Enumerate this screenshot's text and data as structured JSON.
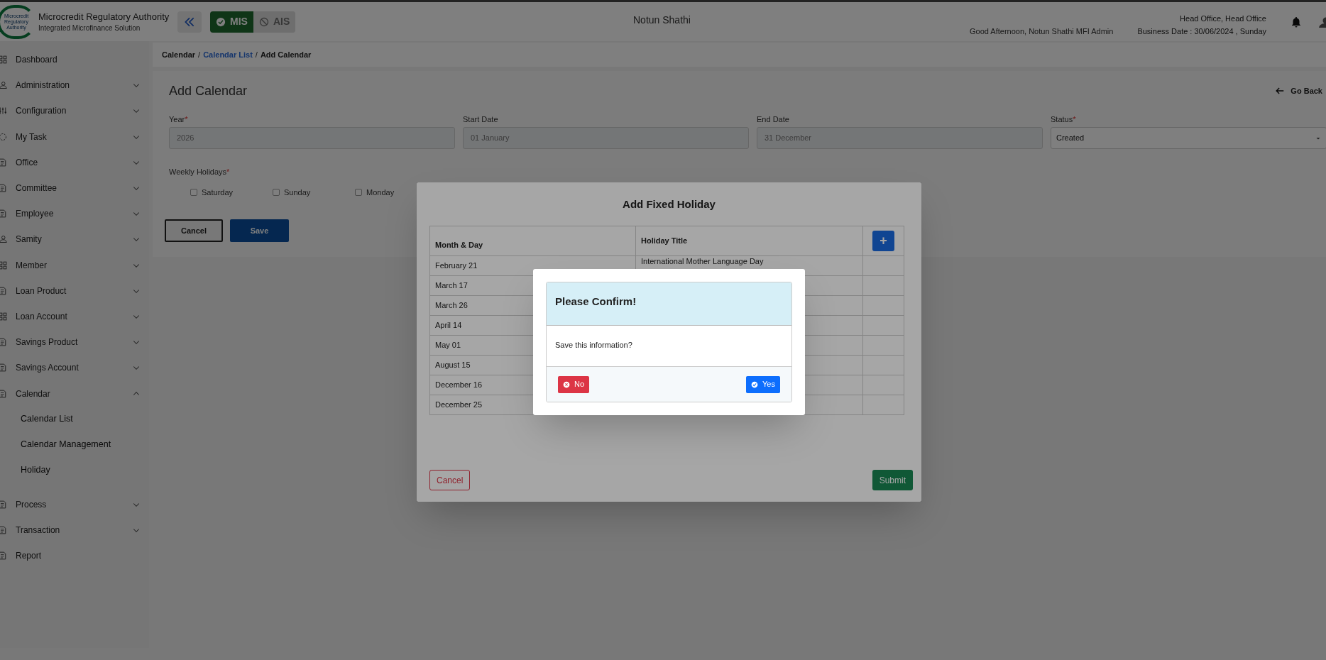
{
  "header": {
    "org_name": "Microcredit Regulatory Authority",
    "org_subtitle": "Integrated Microfinance Solution",
    "logo_text": [
      "Microcredit",
      "Regulatory",
      "Authority"
    ],
    "modules": [
      {
        "label": "MIS",
        "selected": true
      },
      {
        "label": "AIS",
        "selected": false
      }
    ],
    "center_title": "Notun Shathi",
    "greeting": "Good Afternoon, Notun Shathi MFI Admin",
    "office": "Head Office, Head Office",
    "business_date": "Business Date : 30/06/2024 , Sunday"
  },
  "sidebar": {
    "items": [
      {
        "label": "Dashboard",
        "kind": "link"
      },
      {
        "label": "Administration",
        "kind": "group",
        "expanded": false
      },
      {
        "label": "Configuration",
        "kind": "group",
        "expanded": false
      },
      {
        "label": "My Task",
        "kind": "group",
        "expanded": false
      },
      {
        "label": "Office",
        "kind": "group",
        "expanded": false
      },
      {
        "label": "Committee",
        "kind": "group",
        "expanded": false
      },
      {
        "label": "Employee",
        "kind": "group",
        "expanded": false
      },
      {
        "label": "Samity",
        "kind": "group",
        "expanded": false
      },
      {
        "label": "Member",
        "kind": "group",
        "expanded": false
      },
      {
        "label": "Loan Product",
        "kind": "group",
        "expanded": false
      },
      {
        "label": "Loan Account",
        "kind": "group",
        "expanded": false
      },
      {
        "label": "Savings Product",
        "kind": "group",
        "expanded": false
      },
      {
        "label": "Savings Account",
        "kind": "group",
        "expanded": false
      },
      {
        "label": "Calendar",
        "kind": "group",
        "expanded": true,
        "children": [
          {
            "label": "Calendar List"
          },
          {
            "label": "Calendar Management"
          },
          {
            "label": "Holiday"
          }
        ]
      },
      {
        "label": "Process",
        "kind": "group",
        "expanded": false
      },
      {
        "label": "Transaction",
        "kind": "group",
        "expanded": false
      },
      {
        "label": "Report",
        "kind": "link"
      }
    ]
  },
  "breadcrumb": {
    "separators": [
      "/",
      "/"
    ],
    "items": [
      {
        "label": "Calendar",
        "link": false
      },
      {
        "label": "Calendar List",
        "link": true
      },
      {
        "label": "Add Calendar",
        "link": false
      }
    ]
  },
  "page": {
    "title": "Add Calendar",
    "go_back": "Go Back",
    "fields": [
      {
        "label": "Year",
        "required_mark": "*",
        "value": "2026",
        "kind": "input"
      },
      {
        "label": "Start Date",
        "value": "01 January",
        "kind": "input"
      },
      {
        "label": "End Date",
        "value": "31 December",
        "kind": "input"
      },
      {
        "label": "Status",
        "required_mark": "*",
        "value": "Created",
        "kind": "select"
      }
    ],
    "weekly_holidays": {
      "label": "Weekly Holidays",
      "required_mark": "*",
      "days": [
        {
          "label": "Saturday",
          "checked": false
        },
        {
          "label": "Sunday",
          "checked": false
        },
        {
          "label": "Monday",
          "checked": false
        }
      ]
    },
    "buttons": [
      "Cancel",
      "Save"
    ]
  },
  "fixed_holiday_modal": {
    "title": "Add Fixed Holiday",
    "columns": [
      "Month & Day",
      "Holiday Title"
    ],
    "add_button": "+",
    "rows": [
      {
        "month_day": "February 21",
        "title": "International Mother Language Day"
      },
      {
        "month_day": "March 17"
      },
      {
        "month_day": "March 26"
      },
      {
        "month_day": "April 14"
      },
      {
        "month_day": "May 01"
      },
      {
        "month_day": "August 15"
      },
      {
        "month_day": "December 16"
      },
      {
        "month_day": "December 25"
      }
    ],
    "cancel": "Cancel",
    "submit": "Submit"
  },
  "confirm_dialog": {
    "title": "Please Confirm!",
    "message": "Save this information?",
    "no": "No",
    "yes": "Yes"
  }
}
